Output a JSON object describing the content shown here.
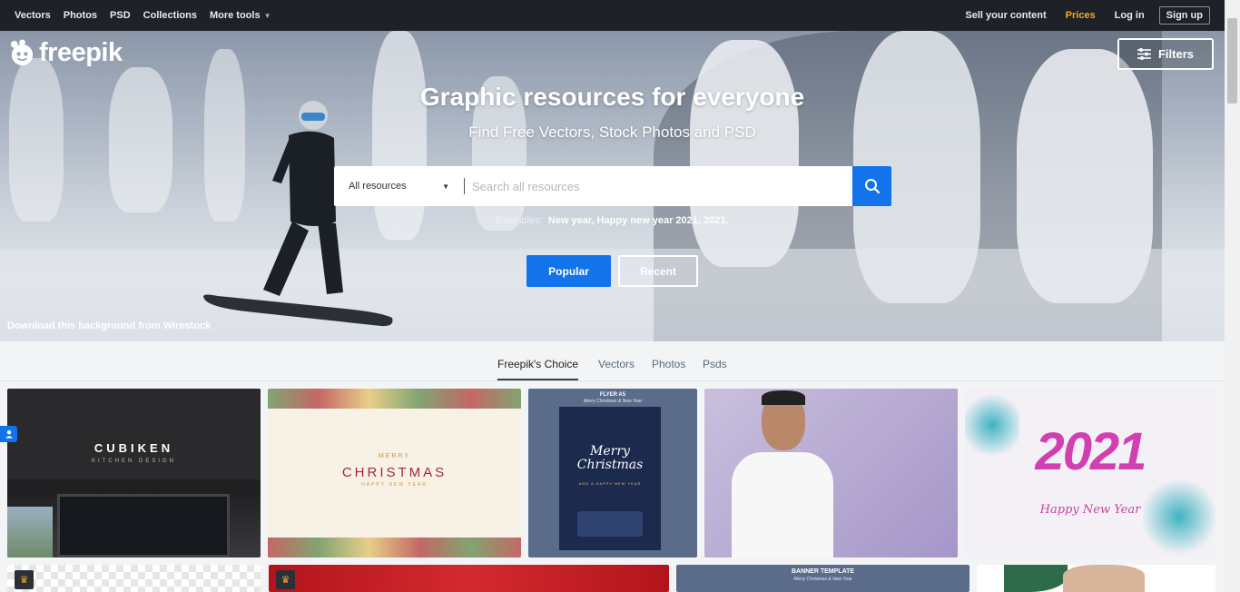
{
  "nav": {
    "left": [
      "Vectors",
      "Photos",
      "PSD",
      "Collections",
      "More tools"
    ],
    "sell": "Sell your content",
    "prices": "Prices",
    "login": "Log in",
    "signup": "Sign up"
  },
  "hero": {
    "logo": "freepik",
    "filters": "Filters",
    "title": "Graphic resources for everyone",
    "subtitle": "Find Free Vectors, Stock Photos and PSD",
    "search_select": "All resources",
    "search_placeholder": "Search all resources",
    "examples_label": "Examples:",
    "examples_values": "New year, Happy new year 2021, 2021.",
    "popular": "Popular",
    "recent": "Recent",
    "credit": "Download this background from Wirestock"
  },
  "tabs": [
    "Freepik's Choice",
    "Vectors",
    "Photos",
    "Psds"
  ],
  "cards": {
    "cubiken_title": "CUBIKEN",
    "cubiken_sub": "KITCHEN DESIGN",
    "merry": "MERRY",
    "christmas": "CHRISTMAS",
    "happy_new_year": "HAPPY NEW YEAR",
    "flyer_label": "FLYER A5",
    "flyer_sub": "Merry Christmas & New Year",
    "flyer_script": "Merry Christmas",
    "flyer_small": "AND A HAPPY NEW YEAR",
    "year": "2021",
    "year_script": "Happy New Year",
    "banner_label": "BANNER TEMPLATE",
    "banner_sub": "Merry Christmas & New Year"
  },
  "colors": {
    "accent": "#1273eb",
    "prices": "#f5a623",
    "topnav": "#1e2228"
  }
}
